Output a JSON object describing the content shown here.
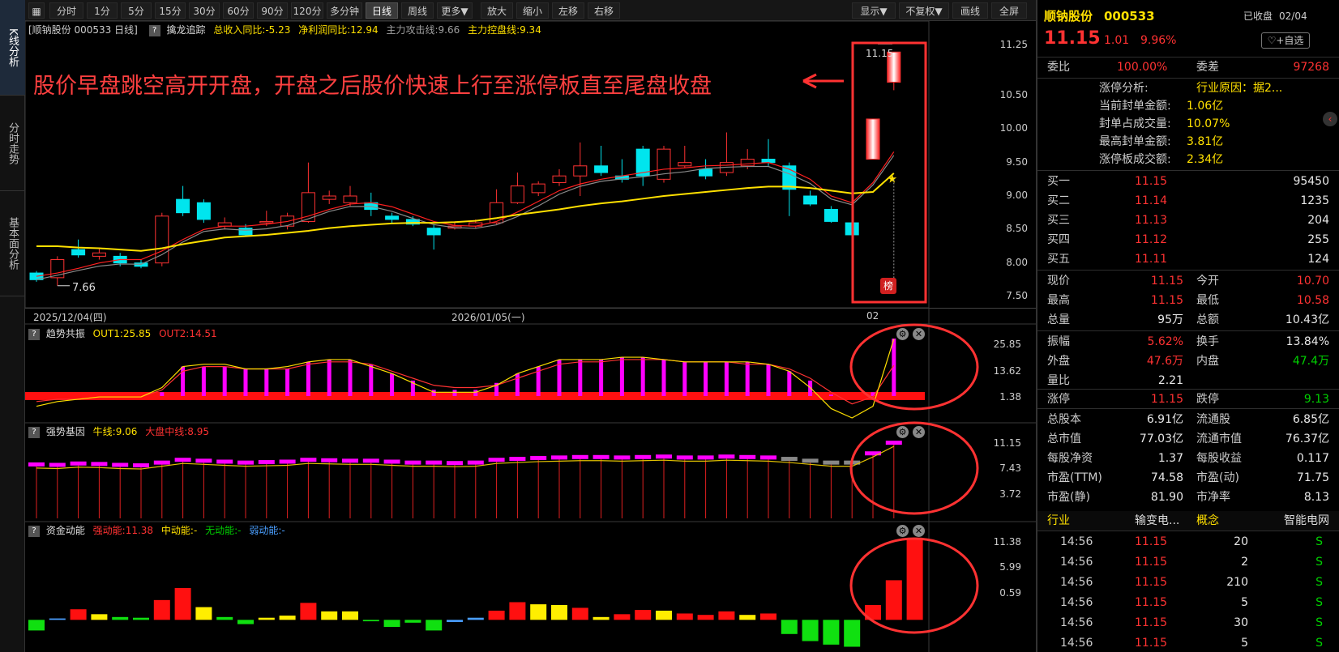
{
  "side_tabs": [
    "K线分析",
    "分时走势",
    "基本面分析"
  ],
  "toolbar": {
    "periods": [
      "分时",
      "1分",
      "5分",
      "15分",
      "30分",
      "60分",
      "90分",
      "120分",
      "多分钟",
      "日线",
      "周线",
      "更多▼"
    ],
    "actions": [
      "放大",
      "缩小",
      "左移",
      "右移"
    ],
    "right": [
      "显示▼",
      "不复权▼",
      "画线",
      "全屏"
    ]
  },
  "main_chart": {
    "title": "[顺钠股份 000533 日线]",
    "indicator_name": "擒龙追踪",
    "values": [
      "总收入同比:-5.23",
      "净利润同比:12.94",
      "主力攻击线:9.66",
      "主力控盘线:9.34"
    ],
    "y_ticks": [
      "11.25",
      "10.50",
      "10.00",
      "9.50",
      "9.00",
      "8.50",
      "8.00",
      "7.50"
    ],
    "annotation": "股价早盘跳空高开开盘，开盘之后股价快速上行至涨停板直至尾盘收盘",
    "high_label": "11.15",
    "low_label": "7.66",
    "badge": "榜",
    "dates": [
      "2025/12/04(四)",
      "2026/01/05(一)",
      "02"
    ]
  },
  "sub_charts": [
    {
      "name": "趋势共振",
      "values": [
        "OUT1:25.85",
        "OUT2:14.51"
      ],
      "colors": [
        "#ffe000",
        "#ff3232"
      ],
      "ticks": [
        "25.85",
        "13.62",
        "1.38"
      ]
    },
    {
      "name": "强势基因",
      "values": [
        "牛线:9.06",
        "大盘中线:8.95"
      ],
      "colors": [
        "#ffe000",
        "#ff3232"
      ],
      "ticks": [
        "11.15",
        "7.43",
        "3.72"
      ]
    },
    {
      "name": "资金动能",
      "values": [
        "强动能:11.38",
        "中动能:-",
        "无动能:-",
        "弱动能:-"
      ],
      "colors": [
        "#ff3232",
        "#ffe000",
        "#00d000",
        "#4a9fff"
      ],
      "ticks": [
        "11.38",
        "5.99",
        "0.59"
      ]
    }
  ],
  "colors": {
    "up": "#ff3232",
    "down": "#00e5ee",
    "ma_yellow": "#ffe000",
    "ma_red": "#ff2020",
    "ma_grey": "#8a8a8a",
    "highlight": "#ff3232",
    "magenta": "#ff00ff"
  },
  "chart_data": {
    "type": "candlestick",
    "ylim": [
      7.5,
      11.25
    ],
    "candles": [
      {
        "o": 7.85,
        "c": 7.75,
        "h": 7.88,
        "l": 7.72
      },
      {
        "o": 7.78,
        "c": 8.05,
        "h": 8.1,
        "l": 7.66
      },
      {
        "o": 8.2,
        "c": 8.12,
        "h": 8.35,
        "l": 8.08
      },
      {
        "o": 8.1,
        "c": 8.15,
        "h": 8.22,
        "l": 8.05
      },
      {
        "o": 8.1,
        "c": 8.0,
        "h": 8.15,
        "l": 7.95
      },
      {
        "o": 8.0,
        "c": 7.95,
        "h": 8.05,
        "l": 7.92
      },
      {
        "o": 8.0,
        "c": 8.7,
        "h": 8.75,
        "l": 7.95
      },
      {
        "o": 8.95,
        "c": 8.75,
        "h": 9.15,
        "l": 8.7
      },
      {
        "o": 8.9,
        "c": 8.65,
        "h": 8.95,
        "l": 8.6
      },
      {
        "o": 8.55,
        "c": 8.6,
        "h": 8.68,
        "l": 8.5
      },
      {
        "o": 8.52,
        "c": 8.42,
        "h": 8.58,
        "l": 8.4
      },
      {
        "o": 8.6,
        "c": 8.62,
        "h": 8.78,
        "l": 8.55
      },
      {
        "o": 8.55,
        "c": 8.7,
        "h": 8.75,
        "l": 8.5
      },
      {
        "o": 8.62,
        "c": 9.05,
        "h": 9.5,
        "l": 8.6
      },
      {
        "o": 8.95,
        "c": 9.0,
        "h": 9.08,
        "l": 8.88
      },
      {
        "o": 8.9,
        "c": 9.0,
        "h": 9.15,
        "l": 8.85
      },
      {
        "o": 8.9,
        "c": 8.8,
        "h": 9.05,
        "l": 8.7
      },
      {
        "o": 8.7,
        "c": 8.65,
        "h": 8.75,
        "l": 8.6
      },
      {
        "o": 8.65,
        "c": 8.58,
        "h": 8.7,
        "l": 8.55
      },
      {
        "o": 8.52,
        "c": 8.42,
        "h": 8.58,
        "l": 8.2
      },
      {
        "o": 8.52,
        "c": 8.55,
        "h": 8.62,
        "l": 8.5
      },
      {
        "o": 8.55,
        "c": 8.6,
        "h": 8.65,
        "l": 8.52
      },
      {
        "o": 8.6,
        "c": 8.9,
        "h": 9.1,
        "l": 8.58
      },
      {
        "o": 8.9,
        "c": 9.15,
        "h": 9.35,
        "l": 8.88
      },
      {
        "o": 9.05,
        "c": 9.18,
        "h": 9.22,
        "l": 9.0
      },
      {
        "o": 9.2,
        "c": 9.3,
        "h": 9.4,
        "l": 9.15
      },
      {
        "o": 9.3,
        "c": 9.45,
        "h": 9.8,
        "l": 9.0
      },
      {
        "o": 9.45,
        "c": 9.35,
        "h": 9.75,
        "l": 9.3
      },
      {
        "o": 9.3,
        "c": 9.25,
        "h": 9.55,
        "l": 9.2
      },
      {
        "o": 9.7,
        "c": 9.3,
        "h": 9.75,
        "l": 9.15
      },
      {
        "o": 9.25,
        "c": 9.7,
        "h": 9.75,
        "l": 9.2
      },
      {
        "o": 9.45,
        "c": 9.5,
        "h": 9.75,
        "l": 9.42
      },
      {
        "o": 9.4,
        "c": 9.3,
        "h": 9.55,
        "l": 9.25
      },
      {
        "o": 9.35,
        "c": 9.5,
        "h": 9.95,
        "l": 9.3
      },
      {
        "o": 9.45,
        "c": 9.55,
        "h": 9.7,
        "l": 9.4
      },
      {
        "o": 9.55,
        "c": 9.5,
        "h": 9.85,
        "l": 9.45
      },
      {
        "o": 9.45,
        "c": 9.1,
        "h": 9.5,
        "l": 8.7
      },
      {
        "o": 9.0,
        "c": 8.88,
        "h": 9.08,
        "l": 8.85
      },
      {
        "o": 8.8,
        "c": 8.62,
        "h": 8.85,
        "l": 8.6
      },
      {
        "o": 8.6,
        "c": 8.42,
        "h": 8.65,
        "l": 8.25
      },
      {
        "o": 9.55,
        "c": 10.15,
        "h": 10.15,
        "l": 9.55
      },
      {
        "o": 10.7,
        "c": 11.15,
        "h": 11.15,
        "l": 10.58
      }
    ],
    "ma_yellow": [
      8.25,
      8.25,
      8.23,
      8.22,
      8.2,
      8.18,
      8.22,
      8.28,
      8.33,
      8.38,
      8.4,
      8.42,
      8.45,
      8.48,
      8.52,
      8.55,
      8.57,
      8.59,
      8.6,
      8.6,
      8.61,
      8.63,
      8.67,
      8.72,
      8.76,
      8.8,
      8.85,
      8.89,
      8.92,
      8.96,
      9.0,
      9.03,
      9.06,
      9.09,
      9.12,
      9.14,
      9.14,
      9.12,
      9.08,
      9.04,
      9.06,
      9.34
    ],
    "ma_red": [
      7.8,
      7.85,
      7.92,
      8.0,
      8.05,
      8.05,
      8.18,
      8.35,
      8.5,
      8.55,
      8.55,
      8.58,
      8.62,
      8.7,
      8.8,
      8.88,
      8.9,
      8.84,
      8.73,
      8.62,
      8.56,
      8.55,
      8.62,
      8.76,
      8.92,
      9.08,
      9.18,
      9.25,
      9.3,
      9.35,
      9.4,
      9.42,
      9.45,
      9.46,
      9.48,
      9.5,
      9.4,
      9.25,
      9.0,
      8.9,
      9.2,
      9.66
    ]
  },
  "sub_data": {
    "trend": {
      "bars": [
        0,
        0,
        0,
        0,
        0,
        0,
        3,
        14,
        14,
        14,
        13,
        13,
        13,
        16,
        17,
        17,
        15,
        11,
        8,
        4,
        4,
        4,
        7,
        11,
        14,
        17,
        17,
        17,
        18,
        18,
        17,
        16,
        16,
        16,
        16,
        15,
        12,
        8,
        2,
        -1,
        3,
        26
      ],
      "out1": [
        -3,
        -1,
        0,
        1,
        1,
        1,
        5,
        14,
        15,
        15,
        13,
        13,
        14,
        16,
        17,
        17,
        14,
        11,
        7,
        3,
        3,
        3,
        6,
        11,
        14,
        17,
        17,
        17,
        18,
        18,
        17,
        16,
        16,
        16,
        16,
        15,
        12,
        5,
        -4,
        -8,
        -3,
        25.85
      ],
      "out2": [
        -1,
        0,
        0,
        1,
        1,
        1,
        4,
        12,
        14,
        14,
        13,
        13,
        13,
        15,
        16,
        16,
        15,
        12,
        9,
        6,
        5,
        5,
        6,
        9,
        12,
        15,
        16,
        16,
        17,
        17,
        17,
        16,
        16,
        16,
        15,
        15,
        13,
        9,
        3,
        -2,
        1,
        14.51
      ]
    },
    "gene": {
      "bar_top": [
        8.8,
        8.75,
        8.9,
        8.85,
        8.75,
        8.7,
        9.0,
        9.3,
        9.2,
        9.1,
        9.0,
        9.05,
        9.1,
        9.3,
        9.25,
        9.2,
        9.2,
        9.1,
        9.0,
        9.0,
        8.95,
        9.0,
        9.3,
        9.4,
        9.5,
        9.55,
        9.6,
        9.6,
        9.55,
        9.6,
        9.65,
        9.55,
        9.55,
        9.65,
        9.6,
        9.55,
        9.4,
        9.2,
        9.0,
        9.0,
        10.0,
        11.15
      ],
      "bar_col": [
        "m",
        "m",
        "m",
        "m",
        "m",
        "m",
        "m",
        "m",
        "m",
        "m",
        "m",
        "m",
        "m",
        "m",
        "m",
        "m",
        "m",
        "m",
        "m",
        "m",
        "m",
        "m",
        "m",
        "m",
        "m",
        "m",
        "m",
        "m",
        "m",
        "m",
        "m",
        "m",
        "m",
        "m",
        "m",
        "m",
        "g",
        "g",
        "g",
        "g",
        "m",
        "m"
      ]
    },
    "money": {
      "bars": [
        -1.5,
        0.2,
        1.5,
        0.8,
        0.4,
        0.3,
        2.8,
        4.5,
        1.8,
        0.4,
        -0.6,
        0.3,
        0.6,
        2.4,
        1.2,
        1.2,
        -0.2,
        -1.0,
        -0.4,
        -1.5,
        -0.3,
        0.3,
        1.3,
        2.5,
        2.2,
        2.1,
        1.7,
        0.4,
        0.8,
        1.4,
        1.3,
        0.9,
        0.7,
        1.2,
        0.7,
        0.9,
        -2.0,
        -3.0,
        -3.5,
        -3.8,
        2.1,
        5.6,
        11.38
      ],
      "col": [
        "g",
        "b",
        "r",
        "y",
        "g",
        "g",
        "r",
        "r",
        "y",
        "g",
        "g",
        "y",
        "y",
        "r",
        "y",
        "y",
        "g",
        "g",
        "g",
        "g",
        "b",
        "b",
        "r",
        "r",
        "y",
        "y",
        "r",
        "y",
        "r",
        "r",
        "y",
        "r",
        "r",
        "r",
        "y",
        "r",
        "g",
        "g",
        "g",
        "g",
        "r",
        "r",
        "r"
      ]
    }
  },
  "panel": {
    "stock_name": "顺钠股份",
    "stock_code": "000533",
    "status": "已收盘",
    "date": "02/04",
    "watch_btn": "+自选",
    "price": "11.15",
    "change": "1.01",
    "change_pct": "9.96%",
    "weibi_label": "委比",
    "weibi": "100.00%",
    "weicha_label": "委差",
    "weicha": "97268",
    "limit_rows": [
      {
        "label": "涨停分析:",
        "value": "行业原因：据2..."
      },
      {
        "label": "当前封单金额:",
        "value": "1.06亿"
      },
      {
        "label": "封单占成交量:",
        "value": "10.07%"
      },
      {
        "label": "最高封单金额:",
        "value": "3.81亿"
      },
      {
        "label": "涨停板成交额:",
        "value": "2.34亿"
      }
    ],
    "bids": [
      {
        "label": "买一",
        "price": "11.15",
        "vol": "95450"
      },
      {
        "label": "买二",
        "price": "11.14",
        "vol": "1235"
      },
      {
        "label": "买三",
        "price": "11.13",
        "vol": "204"
      },
      {
        "label": "买四",
        "price": "11.12",
        "vol": "255"
      },
      {
        "label": "买五",
        "price": "11.11",
        "vol": "124"
      }
    ],
    "stats": [
      [
        {
          "l": "现价",
          "v": "11.15",
          "c": "red"
        },
        {
          "l": "今开",
          "v": "10.70",
          "c": "red"
        }
      ],
      [
        {
          "l": "最高",
          "v": "11.15",
          "c": "red"
        },
        {
          "l": "最低",
          "v": "10.58",
          "c": "red"
        }
      ],
      [
        {
          "l": "总量",
          "v": "95万",
          "c": "white"
        },
        {
          "l": "总额",
          "v": "10.43亿",
          "c": "white"
        }
      ]
    ],
    "stats2": [
      [
        {
          "l": "振幅",
          "v": "5.62%",
          "c": "red"
        },
        {
          "l": "换手",
          "v": "13.84%",
          "c": "white"
        }
      ],
      [
        {
          "l": "外盘",
          "v": "47.6万",
          "c": "red"
        },
        {
          "l": "内盘",
          "v": "47.4万",
          "c": "green"
        }
      ],
      [
        {
          "l": "量比",
          "v": "2.21",
          "c": "white"
        },
        {
          "l": "",
          "v": "",
          "c": "white"
        }
      ]
    ],
    "limits": [
      {
        "l": "涨停",
        "v": "11.15",
        "c": "red"
      },
      {
        "l": "跌停",
        "v": "9.13",
        "c": "green"
      }
    ],
    "fundamentals": [
      [
        {
          "l": "总股本",
          "v": "6.91亿"
        },
        {
          "l": "流通股",
          "v": "6.85亿"
        }
      ],
      [
        {
          "l": "总市值",
          "v": "77.03亿"
        },
        {
          "l": "流通市值",
          "v": "76.37亿"
        }
      ],
      [
        {
          "l": "每股净资",
          "v": "1.37"
        },
        {
          "l": "每股收益",
          "v": "0.117"
        }
      ],
      [
        {
          "l": "市盈(TTM)",
          "v": "74.58"
        },
        {
          "l": "市盈(动)",
          "v": "71.75"
        }
      ],
      [
        {
          "l": "市盈(静)",
          "v": "81.90"
        },
        {
          "l": "市净率",
          "v": "8.13"
        }
      ]
    ],
    "industry_label": "行业",
    "industry": "输变电...",
    "concept_label": "概念",
    "concept": "智能电网",
    "ticks": [
      {
        "t": "14:56",
        "p": "11.15",
        "v": "20",
        "d": "S"
      },
      {
        "t": "14:56",
        "p": "11.15",
        "v": "2",
        "d": "S"
      },
      {
        "t": "14:56",
        "p": "11.15",
        "v": "210",
        "d": "S"
      },
      {
        "t": "14:56",
        "p": "11.15",
        "v": "5",
        "d": "S"
      },
      {
        "t": "14:56",
        "p": "11.15",
        "v": "30",
        "d": "S"
      },
      {
        "t": "14:56",
        "p": "11.15",
        "v": "5",
        "d": "S"
      }
    ]
  }
}
